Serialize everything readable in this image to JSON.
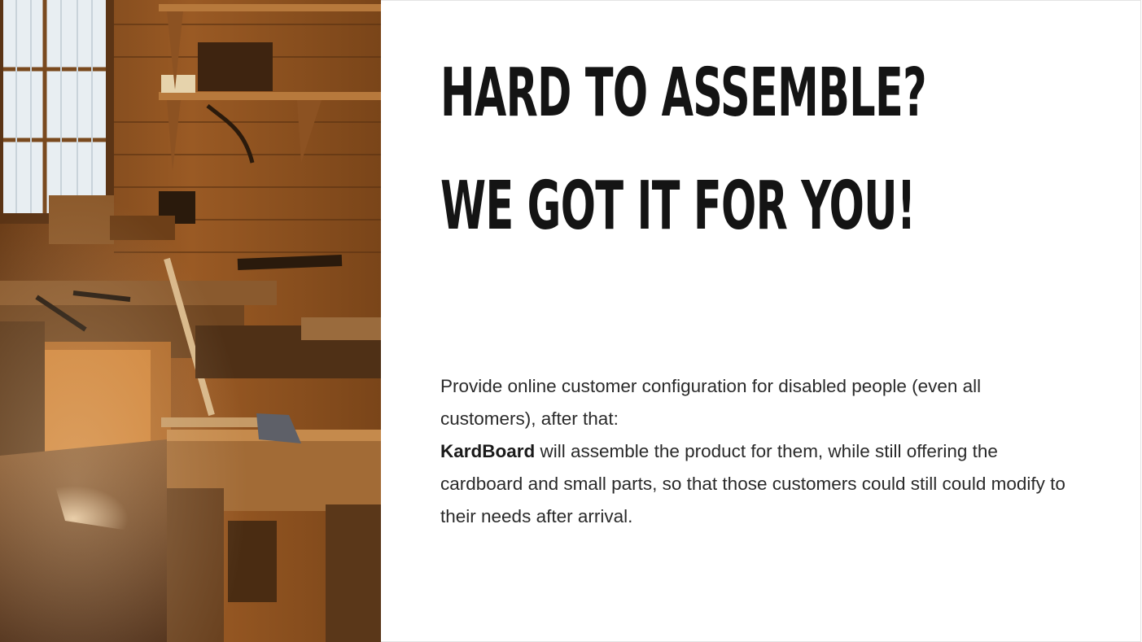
{
  "slide": {
    "headline_line1": "HARD TO ASSEMBLE?",
    "headline_line2": "WE GOT IT FOR YOU!",
    "body": {
      "paragraph1": "Provide online customer configuration for disabled people (even all customers), after that:",
      "brand_name": "KardBoard",
      "paragraph2_rest": " will assemble the product for them, while still offering the cardboard and small parts, so that those customers could still could modify to their needs after arrival."
    },
    "image": {
      "subject": "woodworking-workshop-photo"
    }
  },
  "colors": {
    "background": "#ffffff",
    "headline": "#141414",
    "body_text": "#2a2a2a"
  }
}
